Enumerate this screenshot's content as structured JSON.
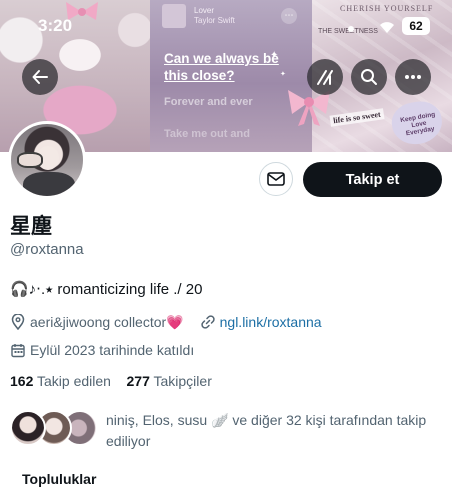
{
  "status_bar": {
    "time": "3:20",
    "battery": "62"
  },
  "banner": {
    "music_title": "Lover",
    "music_artist": "Taylor Swift",
    "lyric_current": "Can we always be this close?",
    "lyric_next": "Forever and ever",
    "lyric_after": "Take me out and",
    "collage_title": "CHERISH YOURSELF",
    "collage_sub": "THE SWEETNESS",
    "sticker_label": "life is so sweet",
    "sticker_heart_text": "Keep doing Love Everyday"
  },
  "header_buttons": {
    "back": "back-arrow-icon",
    "grok": "grok-icon",
    "search": "search-icon",
    "more": "more-icon"
  },
  "profile": {
    "display_name": "星塵",
    "handle": "@roxtanna",
    "bio": "🎧♪‧.⭑ romanticizing life ./ 20",
    "location": "aeri&jiwoong collector💗",
    "website": "ngl.link/roxtanna",
    "joined": "Eylül 2023 tarihinde katıldı",
    "following_count": "162",
    "following_label": "Takip edilen",
    "followers_count": "277",
    "followers_label": "Takipçiler",
    "followed_by": "niniş, Elos, susu 🪽 ve diğer 32 kişi tarafından takip ediliyor"
  },
  "actions": {
    "follow": "Takip et",
    "message": "mail-icon"
  },
  "sections": {
    "communities": "Topluluklar"
  },
  "colors": {
    "follow_button": "#0f1419",
    "link": "#1d6fa5",
    "secondary_text": "#536471"
  }
}
